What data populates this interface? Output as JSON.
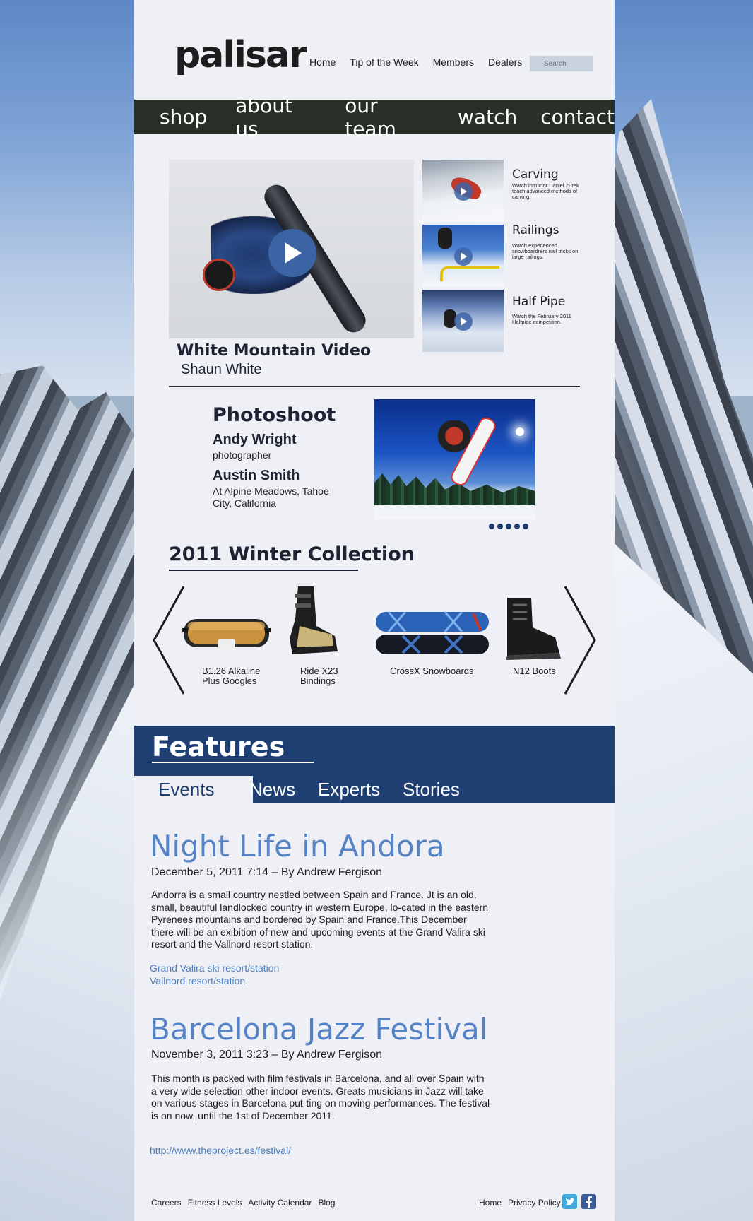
{
  "brand": {
    "logo": "palisar"
  },
  "top_nav": {
    "items": [
      "Home",
      "Tip of the Week",
      "Members",
      "Dealers"
    ]
  },
  "search": {
    "label": "Search"
  },
  "main_nav": {
    "items": [
      "shop",
      "about us",
      "our team",
      "watch",
      "contact"
    ]
  },
  "featured_video": {
    "title": "White Mountain Video",
    "subtitle": "Shaun White"
  },
  "video_list": [
    {
      "title": "Carving",
      "description": "Watch intructor Daniel Zurek teach advanced methods of carving."
    },
    {
      "title": "Railings",
      "description": "Watch experienced snowboardrers nail tricks on large railings."
    },
    {
      "title": "Half Pipe",
      "description": "Watch the February 2011 Halfpipe competition."
    }
  ],
  "photoshoot": {
    "title": "Photoshoot",
    "photographer_name": "Andy Wright",
    "photographer_role": "photographer",
    "subject_name": "Austin Smith",
    "subject_location": "At Alpine Meadows, Tahoe City, California",
    "slide_count": 5
  },
  "collection": {
    "title": "2011 Winter Collection",
    "products": [
      {
        "label": "B1.26 Alkaline Plus Googles",
        "icon": "goggles-icon"
      },
      {
        "label": "Ride X23 Bindings",
        "icon": "binding-icon"
      },
      {
        "label": "CrossX Snowboards",
        "icon": "snowboard-icon"
      },
      {
        "label": "N12 Boots",
        "icon": "boot-icon"
      }
    ]
  },
  "features": {
    "title": "Features",
    "tabs": [
      "Events",
      "News",
      "Experts",
      "Stories"
    ],
    "active_tab": "Events"
  },
  "articles": [
    {
      "title": "Night Life in Andora",
      "meta": "December 5, 2011  7:14 – By Andrew Fergison",
      "body": "Andorra is a small country nestled  between  Spain and France. Jt is an old,  small, beautiful  landlocked country in western Europe, lo-cated in the eastern Pyrenees mountains and bordered by Spain and France.This December there will be an exibition of new and upcoming events at the Grand Valira ski resort and the Vallnord resort station.",
      "links": [
        "Grand Valira ski resort/station",
        "Vallnord resort/station"
      ]
    },
    {
      "title": "Barcelona Jazz Festival",
      "meta": "November 3, 2011  3:23 – By Andrew Fergison",
      "body": "This month is packed with film festivals in Barcelona, and all over Spain with a very wide selection other indoor events. Greats musicians in Jazz will take on various stages in Barcelona put-ting on moving performances. The festival is on now, until the 1st of December 2011.",
      "links": [
        "http://www.theproject.es/festival/"
      ]
    }
  ],
  "footer": {
    "left_links": [
      "Careers",
      "Fitness Levels",
      "Activity Calendar",
      "Blog"
    ],
    "right_links": [
      "Home",
      "Privacy Policy"
    ],
    "social": [
      {
        "name": "twitter-icon",
        "color": "#3fa9dc"
      },
      {
        "name": "facebook-icon",
        "color": "#3b5b9a"
      }
    ]
  },
  "colors": {
    "nav_bar": "#282f26",
    "features_band": "#1f3e72",
    "article_title": "#5583c6",
    "link": "#4a7ec0",
    "panel": "#eef0f5"
  }
}
